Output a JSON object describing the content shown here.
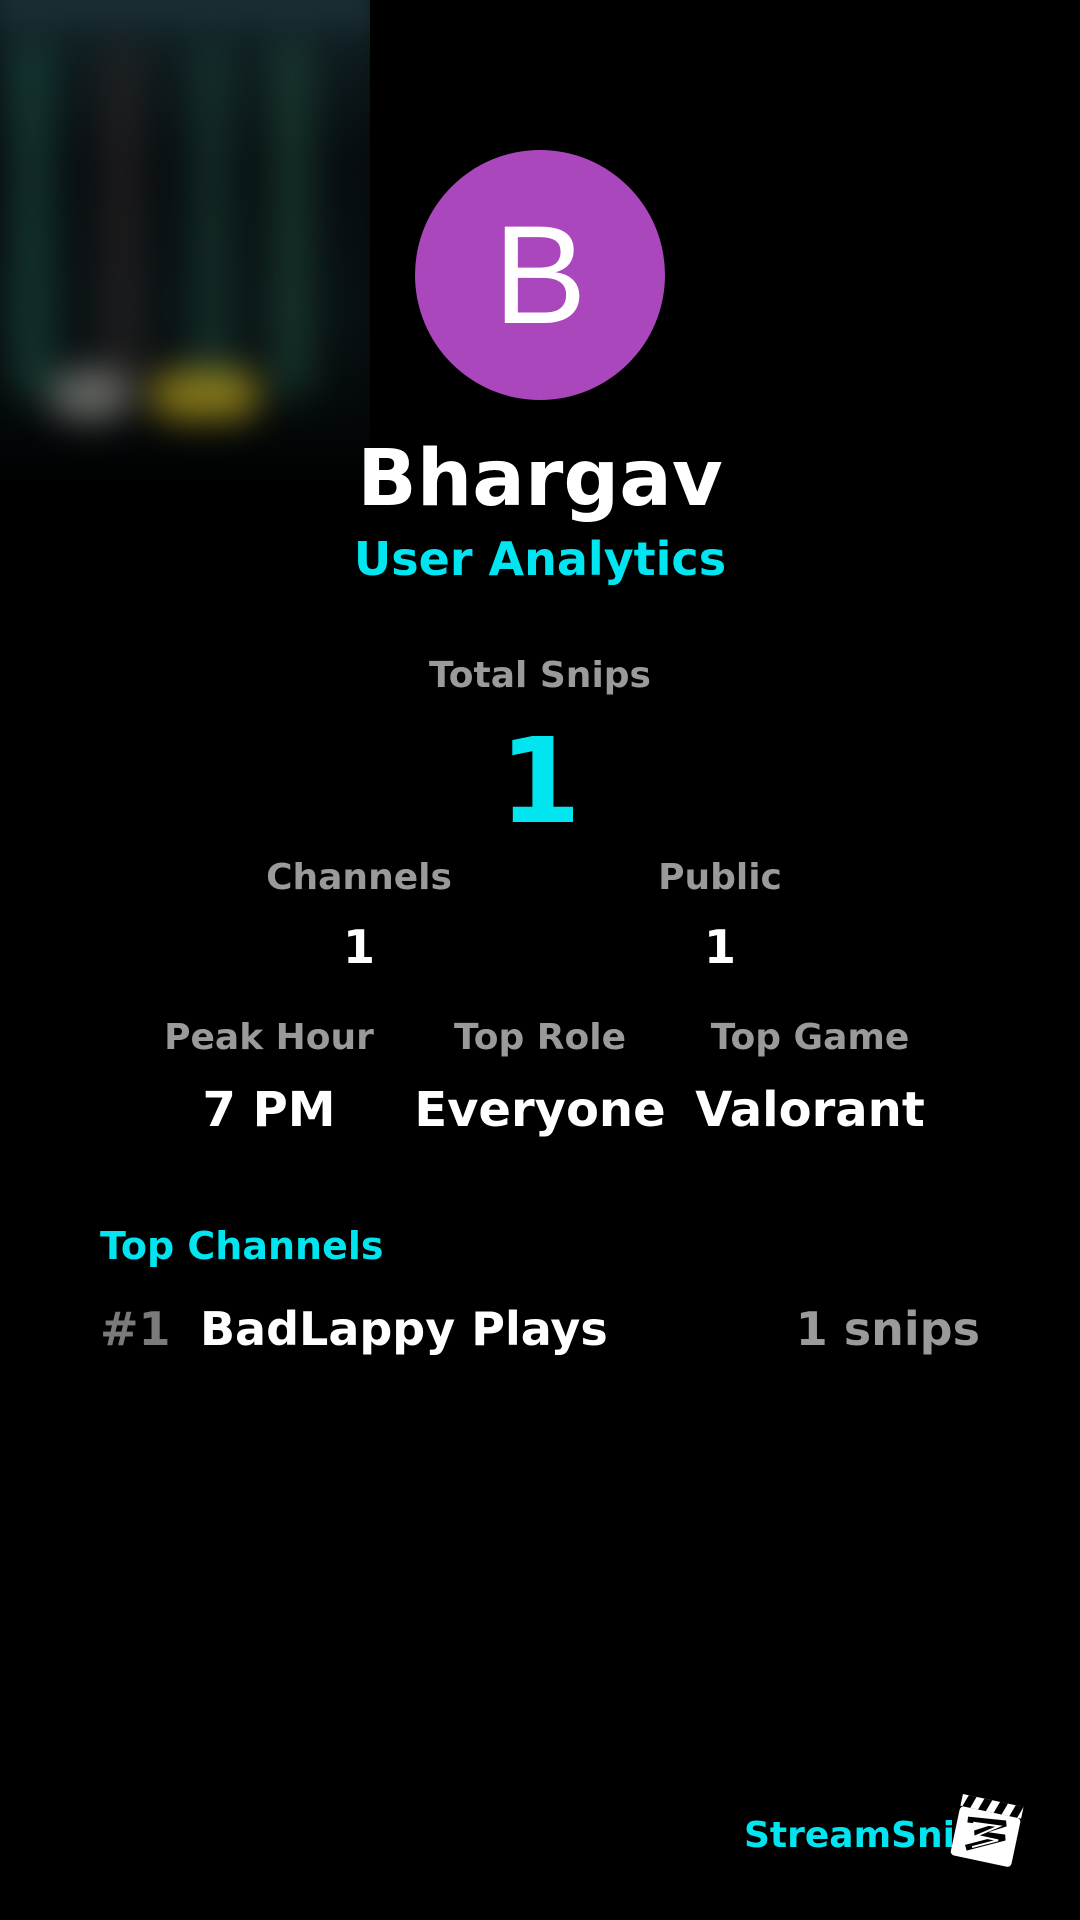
{
  "profile": {
    "avatar_letter": "B",
    "avatar_color": "#ab47bc",
    "name": "Bhargav",
    "subtitle": "User Analytics"
  },
  "totals": {
    "label": "Total Snips",
    "value": "1"
  },
  "stats_row1": [
    {
      "label": "Channels",
      "value": "1"
    },
    {
      "label": "Public",
      "value": "1"
    }
  ],
  "stats_row2": [
    {
      "label": "Peak Hour",
      "value": "7 PM"
    },
    {
      "label": "Top Role",
      "value": "Everyone"
    },
    {
      "label": "Top Game",
      "value": "Valorant"
    }
  ],
  "top_channels": {
    "title": "Top Channels",
    "items": [
      {
        "rank": "#1",
        "name": "BadLappy Plays",
        "count": "1 snips"
      }
    ]
  },
  "brand": {
    "name": "StreamSnip",
    "logo_icon": "clapperboard-icon"
  },
  "colors": {
    "accent": "#00e5f0",
    "background": "#000000",
    "muted": "#9a9a9a"
  }
}
